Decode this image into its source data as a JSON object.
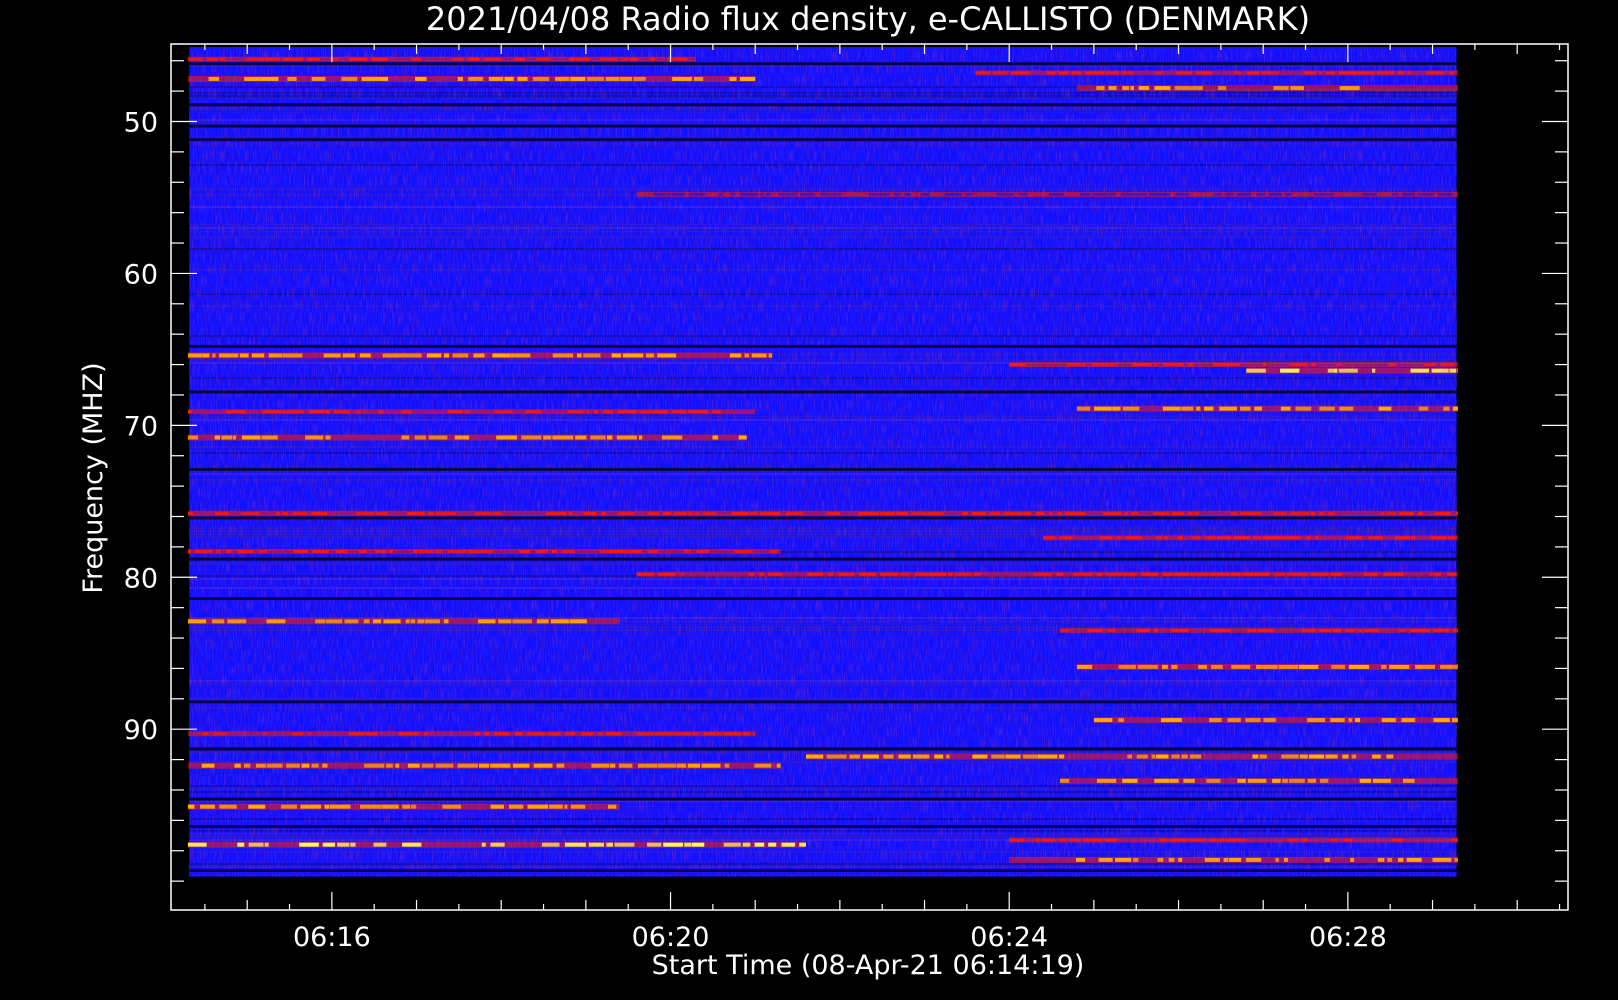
{
  "chart_data": {
    "type": "heatmap",
    "title": "2021/04/08  Radio flux density, e-CALLISTO (DENMARK)",
    "xlabel": "Start Time (08-Apr-21 06:14:19)",
    "ylabel": "Frequency (MHZ)",
    "x_ticks": [
      "06:16",
      "06:20",
      "06:24",
      "06:28"
    ],
    "y_ticks": [
      "50",
      "60",
      "70",
      "80",
      "90"
    ],
    "x_tick_minutes": [
      16,
      20,
      24,
      28
    ],
    "y_tick_values": [
      50,
      60,
      70,
      80,
      90
    ],
    "xlim_minutes": [
      14.1,
      30.6
    ],
    "ylim_mhz": [
      44.9,
      101.9
    ],
    "data_extent": {
      "time_start": "06:14:19",
      "time_end": "06:29:17",
      "freq_min": 45.1,
      "freq_max": 99.7
    },
    "grid": false,
    "colormap": [
      "#000000",
      "#1010ff",
      "#2a1ad0",
      "#ff1a00",
      "#ffb000",
      "#ffff60"
    ],
    "bright_bands_mhz": [
      {
        "f": 45.9,
        "t0": 14.3,
        "t1": 20.3,
        "level": 3
      },
      {
        "f": 46.8,
        "t0": 23.6,
        "t1": 29.3,
        "level": 3
      },
      {
        "f": 47.2,
        "t0": 14.3,
        "t1": 21.0,
        "level": 4
      },
      {
        "f": 47.8,
        "t0": 24.8,
        "t1": 29.3,
        "level": 4
      },
      {
        "f": 54.8,
        "t0": 19.6,
        "t1": 29.3,
        "level": 2
      },
      {
        "f": 65.4,
        "t0": 14.3,
        "t1": 21.2,
        "level": 4
      },
      {
        "f": 66.0,
        "t0": 24.0,
        "t1": 29.3,
        "level": 3
      },
      {
        "f": 66.4,
        "t0": 26.8,
        "t1": 29.3,
        "level": 5
      },
      {
        "f": 69.1,
        "t0": 14.3,
        "t1": 21.0,
        "level": 3
      },
      {
        "f": 68.9,
        "t0": 24.8,
        "t1": 29.3,
        "level": 4
      },
      {
        "f": 70.8,
        "t0": 14.3,
        "t1": 20.9,
        "level": 4
      },
      {
        "f": 75.8,
        "t0": 14.3,
        "t1": 29.3,
        "level": 3
      },
      {
        "f": 77.4,
        "t0": 24.4,
        "t1": 29.3,
        "level": 3
      },
      {
        "f": 78.3,
        "t0": 14.3,
        "t1": 21.3,
        "level": 3
      },
      {
        "f": 79.8,
        "t0": 19.6,
        "t1": 29.3,
        "level": 3
      },
      {
        "f": 82.9,
        "t0": 14.3,
        "t1": 19.4,
        "level": 4
      },
      {
        "f": 83.5,
        "t0": 24.6,
        "t1": 29.3,
        "level": 3
      },
      {
        "f": 85.9,
        "t0": 24.8,
        "t1": 29.3,
        "level": 4
      },
      {
        "f": 89.4,
        "t0": 25.0,
        "t1": 29.3,
        "level": 4
      },
      {
        "f": 90.3,
        "t0": 14.3,
        "t1": 21.0,
        "level": 3
      },
      {
        "f": 91.8,
        "t0": 21.6,
        "t1": 29.3,
        "level": 4
      },
      {
        "f": 92.4,
        "t0": 14.3,
        "t1": 21.3,
        "level": 4
      },
      {
        "f": 93.4,
        "t0": 24.6,
        "t1": 29.3,
        "level": 4
      },
      {
        "f": 95.1,
        "t0": 14.3,
        "t1": 19.4,
        "level": 4
      },
      {
        "f": 97.6,
        "t0": 14.3,
        "t1": 21.6,
        "level": 5
      },
      {
        "f": 97.3,
        "t0": 24.0,
        "t1": 29.3,
        "level": 3
      },
      {
        "f": 98.6,
        "t0": 24.0,
        "t1": 29.3,
        "level": 4
      }
    ],
    "dark_bands_mhz": [
      46.2,
      48.9,
      50.3,
      51.2,
      64.8,
      67.8,
      72.9,
      76.1,
      78.8,
      81.4,
      88.2,
      91.3,
      94.6,
      96.4,
      99.3
    ]
  }
}
